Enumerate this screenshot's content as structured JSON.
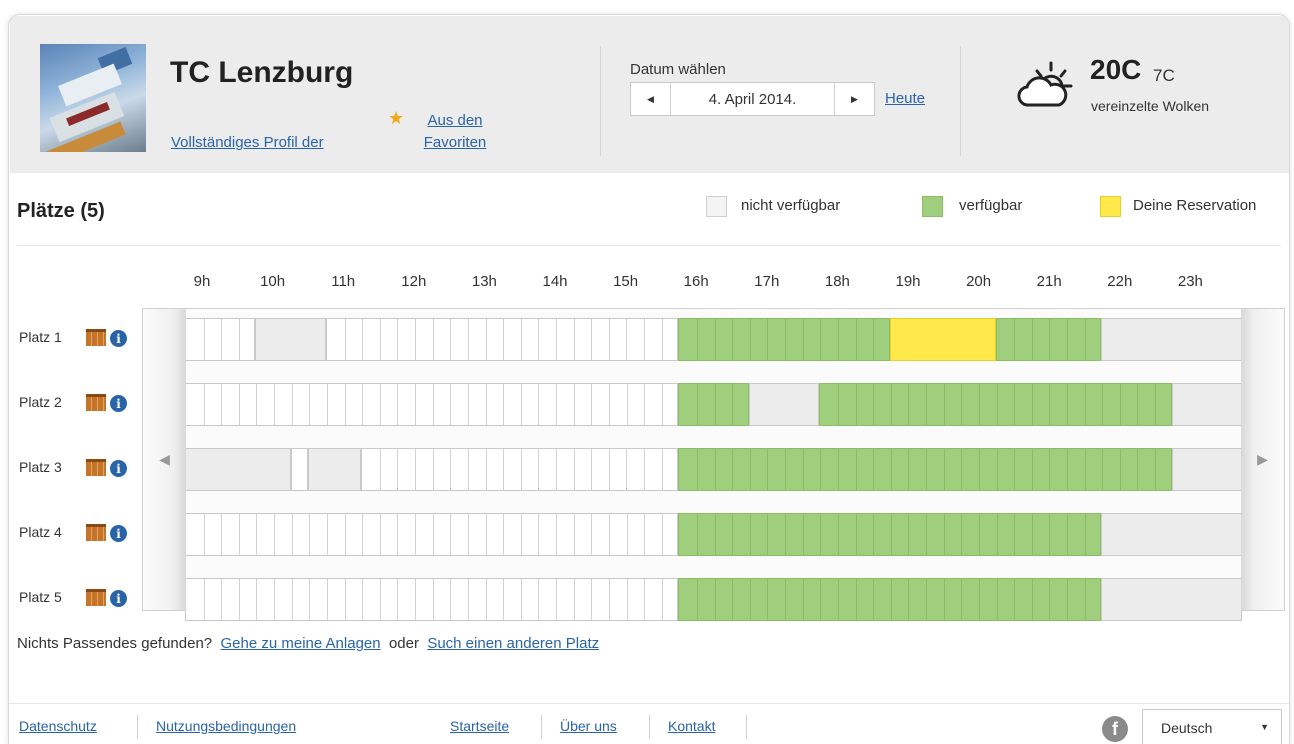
{
  "club": {
    "name": "TC Lenzburg",
    "profile_link": "Vollständiges Profil der",
    "favorites_link": "Aus den Favoriten"
  },
  "date": {
    "label": "Datum wählen",
    "value": "4. April 2014.",
    "today": "Heute"
  },
  "weather": {
    "high": "20C",
    "low": "7C",
    "description": "vereinzelte Wolken",
    "icon": "partly-cloudy-icon"
  },
  "courts_title": "Plätze (5)",
  "legend": [
    {
      "label": "nicht verfügbar",
      "color": "#f4f4f4"
    },
    {
      "label": "verfügbar",
      "color": "#9fcf7c"
    },
    {
      "label": "Deine Reservation",
      "color": "#ffe84a"
    }
  ],
  "hours": [
    "9h",
    "10h",
    "11h",
    "12h",
    "13h",
    "14h",
    "15h",
    "16h",
    "17h",
    "18h",
    "19h",
    "20h",
    "21h",
    "22h",
    "23h"
  ],
  "courts": [
    {
      "label": "Platz 1",
      "segments": [
        {
          "status": "empty",
          "from": 0,
          "to": 4
        },
        {
          "status": "not-available",
          "from": 4,
          "to": 8
        },
        {
          "status": "empty",
          "from": 8,
          "to": 28
        },
        {
          "status": "available",
          "from": 28,
          "to": 40
        },
        {
          "status": "reserved",
          "from": 40,
          "to": 46
        },
        {
          "status": "available",
          "from": 46,
          "to": 52
        },
        {
          "status": "not-available",
          "from": 52,
          "to": 60
        }
      ]
    },
    {
      "label": "Platz 2",
      "segments": [
        {
          "status": "empty",
          "from": 0,
          "to": 28
        },
        {
          "status": "available",
          "from": 28,
          "to": 32
        },
        {
          "status": "not-available",
          "from": 32,
          "to": 36
        },
        {
          "status": "available",
          "from": 36,
          "to": 56
        },
        {
          "status": "not-available",
          "from": 56,
          "to": 60
        }
      ]
    },
    {
      "label": "Platz 3",
      "segments": [
        {
          "status": "not-available",
          "from": 0,
          "to": 6
        },
        {
          "status": "empty",
          "from": 6,
          "to": 7
        },
        {
          "status": "not-available",
          "from": 7,
          "to": 10
        },
        {
          "status": "empty",
          "from": 10,
          "to": 28
        },
        {
          "status": "available",
          "from": 28,
          "to": 56
        },
        {
          "status": "not-available",
          "from": 56,
          "to": 60
        }
      ]
    },
    {
      "label": "Platz 4",
      "segments": [
        {
          "status": "empty",
          "from": 0,
          "to": 28
        },
        {
          "status": "available",
          "from": 28,
          "to": 52
        },
        {
          "status": "not-available",
          "from": 52,
          "to": 60
        }
      ]
    },
    {
      "label": "Platz 5",
      "segments": [
        {
          "status": "empty",
          "from": 0,
          "to": 28
        },
        {
          "status": "available",
          "from": 28,
          "to": 52
        },
        {
          "status": "not-available",
          "from": 52,
          "to": 60
        }
      ]
    }
  ],
  "not_found": {
    "text": "Nichts Passendes gefunden?",
    "link1": "Gehe zu meine Anlagen",
    "middle": "oder",
    "link2": "Such einen anderen Platz"
  },
  "footer": {
    "privacy": "Datenschutz",
    "terms": "Nutzungsbedingungen",
    "home": "Startseite",
    "about": "Über uns",
    "contact": "Kontakt",
    "language": "Deutsch"
  }
}
